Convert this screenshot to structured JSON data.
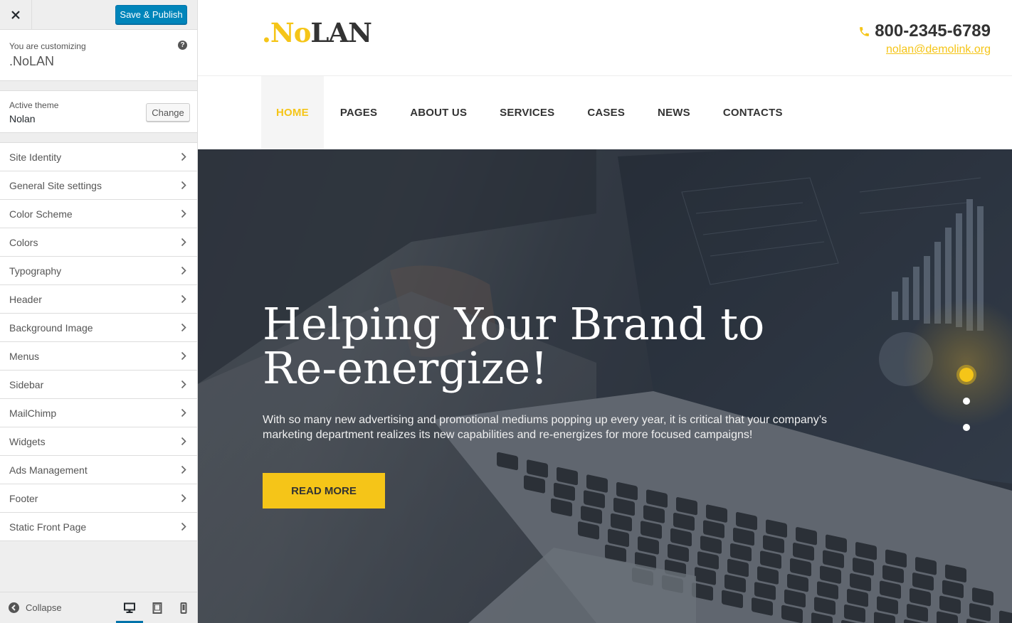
{
  "customizer": {
    "save_label": "Save & Publish",
    "customizing_label": "You are customizing",
    "site_name": ".NoLAN",
    "help_icon": "?",
    "active_theme_label": "Active theme",
    "theme_name": "Nolan",
    "change_label": "Change",
    "sections": [
      {
        "label": "Site Identity"
      },
      {
        "label": "General Site settings"
      },
      {
        "label": "Color Scheme"
      },
      {
        "label": "Colors"
      },
      {
        "label": "Typography"
      },
      {
        "label": "Header"
      },
      {
        "label": "Background Image"
      },
      {
        "label": "Menus"
      },
      {
        "label": "Sidebar"
      },
      {
        "label": "MailChimp"
      },
      {
        "label": "Widgets"
      },
      {
        "label": "Ads Management"
      },
      {
        "label": "Footer"
      },
      {
        "label": "Static Front Page"
      }
    ],
    "collapse_label": "Collapse",
    "preview_device": "desktop",
    "accent_color": "#0085ba"
  },
  "site": {
    "logo_prefix": ".No",
    "logo_suffix": "LAN",
    "phone": "800-2345-6789",
    "email": "nolan@demolink.org",
    "brand_color": "#f5c518",
    "nav": [
      {
        "label": "HOME",
        "active": true
      },
      {
        "label": "PAGES"
      },
      {
        "label": "ABOUT US"
      },
      {
        "label": "SERVICES"
      },
      {
        "label": "CASES"
      },
      {
        "label": "NEWS"
      },
      {
        "label": "CONTACTS"
      }
    ],
    "hero": {
      "title_line1": "Helping Your Brand to",
      "title_line2": "Re-energize!",
      "text": "With so many new advertising and promotional mediums popping up every year, it is critical that your company’s marketing department realizes its new capabilities and re-energizes for more focused campaigns!",
      "button_label": "READ MORE",
      "slides_count": 3,
      "active_slide": 1
    }
  }
}
